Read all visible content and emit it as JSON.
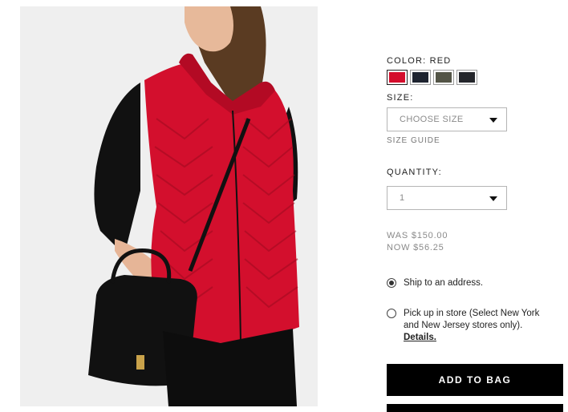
{
  "product": {
    "image_alt": "Model wearing red quilted puffer vest with black crossbody bag",
    "color_label": "COLOR: RED",
    "swatches": [
      {
        "name": "Red",
        "color": "#d40d2c",
        "selected": true
      },
      {
        "name": "Navy",
        "color": "#1e2430",
        "selected": false
      },
      {
        "name": "Olive",
        "color": "#535446",
        "selected": false
      },
      {
        "name": "Black",
        "color": "#24262b",
        "selected": false
      }
    ],
    "size_label": "SIZE:",
    "size_value": "CHOOSE SIZE",
    "size_guide": "SIZE GUIDE",
    "quantity_label": "QUANTITY:",
    "quantity_value": "1",
    "was_price": "WAS $150.00",
    "now_price": "NOW $56.25",
    "ship_option": "Ship to an address.",
    "pickup_option": "Pick up in store (Select New York and New Jersey stores only).",
    "details_link": "Details.",
    "add_to_bag": "ADD TO BAG"
  }
}
